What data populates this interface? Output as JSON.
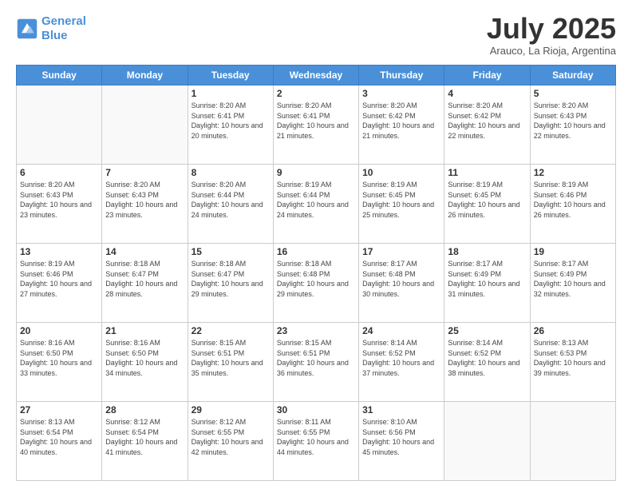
{
  "header": {
    "logo_line1": "General",
    "logo_line2": "Blue",
    "month_title": "July 2025",
    "subtitle": "Arauco, La Rioja, Argentina"
  },
  "weekdays": [
    "Sunday",
    "Monday",
    "Tuesday",
    "Wednesday",
    "Thursday",
    "Friday",
    "Saturday"
  ],
  "weeks": [
    [
      {
        "day": "",
        "sunrise": "",
        "sunset": "",
        "daylight": ""
      },
      {
        "day": "",
        "sunrise": "",
        "sunset": "",
        "daylight": ""
      },
      {
        "day": "1",
        "sunrise": "Sunrise: 8:20 AM",
        "sunset": "Sunset: 6:41 PM",
        "daylight": "Daylight: 10 hours and 20 minutes."
      },
      {
        "day": "2",
        "sunrise": "Sunrise: 8:20 AM",
        "sunset": "Sunset: 6:41 PM",
        "daylight": "Daylight: 10 hours and 21 minutes."
      },
      {
        "day": "3",
        "sunrise": "Sunrise: 8:20 AM",
        "sunset": "Sunset: 6:42 PM",
        "daylight": "Daylight: 10 hours and 21 minutes."
      },
      {
        "day": "4",
        "sunrise": "Sunrise: 8:20 AM",
        "sunset": "Sunset: 6:42 PM",
        "daylight": "Daylight: 10 hours and 22 minutes."
      },
      {
        "day": "5",
        "sunrise": "Sunrise: 8:20 AM",
        "sunset": "Sunset: 6:43 PM",
        "daylight": "Daylight: 10 hours and 22 minutes."
      }
    ],
    [
      {
        "day": "6",
        "sunrise": "Sunrise: 8:20 AM",
        "sunset": "Sunset: 6:43 PM",
        "daylight": "Daylight: 10 hours and 23 minutes."
      },
      {
        "day": "7",
        "sunrise": "Sunrise: 8:20 AM",
        "sunset": "Sunset: 6:43 PM",
        "daylight": "Daylight: 10 hours and 23 minutes."
      },
      {
        "day": "8",
        "sunrise": "Sunrise: 8:20 AM",
        "sunset": "Sunset: 6:44 PM",
        "daylight": "Daylight: 10 hours and 24 minutes."
      },
      {
        "day": "9",
        "sunrise": "Sunrise: 8:19 AM",
        "sunset": "Sunset: 6:44 PM",
        "daylight": "Daylight: 10 hours and 24 minutes."
      },
      {
        "day": "10",
        "sunrise": "Sunrise: 8:19 AM",
        "sunset": "Sunset: 6:45 PM",
        "daylight": "Daylight: 10 hours and 25 minutes."
      },
      {
        "day": "11",
        "sunrise": "Sunrise: 8:19 AM",
        "sunset": "Sunset: 6:45 PM",
        "daylight": "Daylight: 10 hours and 26 minutes."
      },
      {
        "day": "12",
        "sunrise": "Sunrise: 8:19 AM",
        "sunset": "Sunset: 6:46 PM",
        "daylight": "Daylight: 10 hours and 26 minutes."
      }
    ],
    [
      {
        "day": "13",
        "sunrise": "Sunrise: 8:19 AM",
        "sunset": "Sunset: 6:46 PM",
        "daylight": "Daylight: 10 hours and 27 minutes."
      },
      {
        "day": "14",
        "sunrise": "Sunrise: 8:18 AM",
        "sunset": "Sunset: 6:47 PM",
        "daylight": "Daylight: 10 hours and 28 minutes."
      },
      {
        "day": "15",
        "sunrise": "Sunrise: 8:18 AM",
        "sunset": "Sunset: 6:47 PM",
        "daylight": "Daylight: 10 hours and 29 minutes."
      },
      {
        "day": "16",
        "sunrise": "Sunrise: 8:18 AM",
        "sunset": "Sunset: 6:48 PM",
        "daylight": "Daylight: 10 hours and 29 minutes."
      },
      {
        "day": "17",
        "sunrise": "Sunrise: 8:17 AM",
        "sunset": "Sunset: 6:48 PM",
        "daylight": "Daylight: 10 hours and 30 minutes."
      },
      {
        "day": "18",
        "sunrise": "Sunrise: 8:17 AM",
        "sunset": "Sunset: 6:49 PM",
        "daylight": "Daylight: 10 hours and 31 minutes."
      },
      {
        "day": "19",
        "sunrise": "Sunrise: 8:17 AM",
        "sunset": "Sunset: 6:49 PM",
        "daylight": "Daylight: 10 hours and 32 minutes."
      }
    ],
    [
      {
        "day": "20",
        "sunrise": "Sunrise: 8:16 AM",
        "sunset": "Sunset: 6:50 PM",
        "daylight": "Daylight: 10 hours and 33 minutes."
      },
      {
        "day": "21",
        "sunrise": "Sunrise: 8:16 AM",
        "sunset": "Sunset: 6:50 PM",
        "daylight": "Daylight: 10 hours and 34 minutes."
      },
      {
        "day": "22",
        "sunrise": "Sunrise: 8:15 AM",
        "sunset": "Sunset: 6:51 PM",
        "daylight": "Daylight: 10 hours and 35 minutes."
      },
      {
        "day": "23",
        "sunrise": "Sunrise: 8:15 AM",
        "sunset": "Sunset: 6:51 PM",
        "daylight": "Daylight: 10 hours and 36 minutes."
      },
      {
        "day": "24",
        "sunrise": "Sunrise: 8:14 AM",
        "sunset": "Sunset: 6:52 PM",
        "daylight": "Daylight: 10 hours and 37 minutes."
      },
      {
        "day": "25",
        "sunrise": "Sunrise: 8:14 AM",
        "sunset": "Sunset: 6:52 PM",
        "daylight": "Daylight: 10 hours and 38 minutes."
      },
      {
        "day": "26",
        "sunrise": "Sunrise: 8:13 AM",
        "sunset": "Sunset: 6:53 PM",
        "daylight": "Daylight: 10 hours and 39 minutes."
      }
    ],
    [
      {
        "day": "27",
        "sunrise": "Sunrise: 8:13 AM",
        "sunset": "Sunset: 6:54 PM",
        "daylight": "Daylight: 10 hours and 40 minutes."
      },
      {
        "day": "28",
        "sunrise": "Sunrise: 8:12 AM",
        "sunset": "Sunset: 6:54 PM",
        "daylight": "Daylight: 10 hours and 41 minutes."
      },
      {
        "day": "29",
        "sunrise": "Sunrise: 8:12 AM",
        "sunset": "Sunset: 6:55 PM",
        "daylight": "Daylight: 10 hours and 42 minutes."
      },
      {
        "day": "30",
        "sunrise": "Sunrise: 8:11 AM",
        "sunset": "Sunset: 6:55 PM",
        "daylight": "Daylight: 10 hours and 44 minutes."
      },
      {
        "day": "31",
        "sunrise": "Sunrise: 8:10 AM",
        "sunset": "Sunset: 6:56 PM",
        "daylight": "Daylight: 10 hours and 45 minutes."
      },
      {
        "day": "",
        "sunrise": "",
        "sunset": "",
        "daylight": ""
      },
      {
        "day": "",
        "sunrise": "",
        "sunset": "",
        "daylight": ""
      }
    ]
  ]
}
